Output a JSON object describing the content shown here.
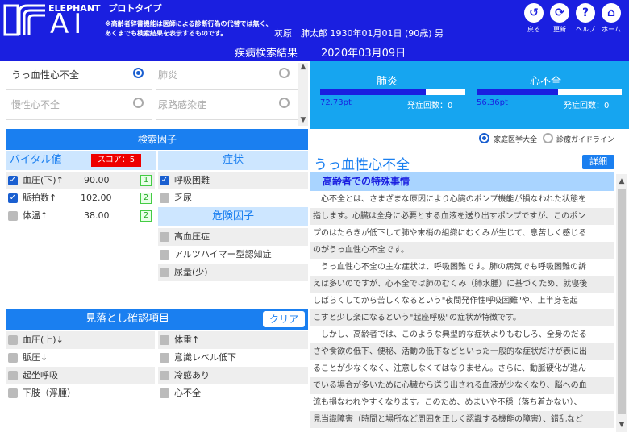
{
  "header": {
    "brand_top": "ELEPHANT",
    "prototype": "プロトタイプ",
    "brand_ai": "AI",
    "disclaimer_line1": "※高齢者辞書機能は医師による診断行為の代替では無く、",
    "disclaimer_line2": "あくまでも検索結果を表示するものです。",
    "patient_info": "灰原　肺太郎 1930年01月01日 (90歳) 男",
    "buttons": [
      {
        "icon": "back-icon",
        "glyph": "↺",
        "label": "戻る"
      },
      {
        "icon": "refresh-icon",
        "glyph": "⟳",
        "label": "更新"
      },
      {
        "icon": "help-icon",
        "glyph": "?",
        "label": "ヘルプ"
      },
      {
        "icon": "home-icon",
        "glyph": "⌂",
        "label": "ホーム"
      }
    ]
  },
  "search_bar": {
    "title": "疾病検索結果",
    "date": "2020年03月09日"
  },
  "diseases": [
    {
      "label": "うっ血性心不全",
      "selected": true
    },
    {
      "label": "肺炎",
      "selected": false
    },
    {
      "label": "慢性心不全",
      "selected": false
    },
    {
      "label": "尿路感染症",
      "selected": false
    }
  ],
  "results": [
    {
      "name": "肺炎",
      "score": "72.73pt",
      "fraction": 0.73,
      "count_label": "発症回数：0"
    },
    {
      "name": "心不全",
      "score": "56.36pt",
      "fraction": 0.56,
      "count_label": "発症回数：0"
    }
  ],
  "factors": {
    "title": "検索因子",
    "vitals_title": "バイタル値",
    "score_label": "スコア：5",
    "symptoms_title": "症状",
    "risk_title": "危険因子",
    "vitals": [
      {
        "label": "血圧(下)↑",
        "value": "90.00",
        "count": "1",
        "checked": true
      },
      {
        "label": "脈拍数↑",
        "value": "102.00",
        "count": "2",
        "checked": true
      },
      {
        "label": "体温↑",
        "value": "38.00",
        "count": "2",
        "checked": false
      }
    ],
    "symptoms": [
      {
        "label": "呼吸困難",
        "checked": true
      },
      {
        "label": "乏尿",
        "checked": false
      }
    ],
    "risks": [
      {
        "label": "高血圧症"
      },
      {
        "label": "アルツハイマー型認知症"
      },
      {
        "label": "尿量(少)"
      }
    ]
  },
  "checklist": {
    "title": "見落とし確認項目",
    "clear_label": "クリア",
    "left": [
      "血圧(上)↓",
      "脈圧↓",
      "起坐呼吸",
      "下肢（浮腫）"
    ],
    "right": [
      "体重↑",
      "意識レベル低下",
      "冷感あり",
      "心不全"
    ]
  },
  "source": {
    "option1": "家庭医学大全",
    "option2": "診療ガイドライン",
    "selected": 1
  },
  "detail": {
    "title": "うっ血性心不全",
    "button": "詳細",
    "section": "高齢者での特殊事情",
    "lines": [
      "　心不全とは、さまざまな原因により心臓のポンプ機能が損なわれた状態を",
      "指します。心臓は全身に必要とする血液を送り出すポンプですが、このポン",
      "プのはたらきが低下して肺や末梢の組織にむくみが生じて、息苦しく感じる",
      "のがうっ血性心不全です。",
      "　うっ血性心不全の主な症状は、呼吸困難です。肺の病気でも呼吸困難の訴",
      "えは多いのですが、心不全では肺のむくみ（肺水腫）に基づくため、就寝後",
      "しばらくしてから苦しくなるという\"夜間発作性呼吸困難\"や、上半身を起",
      "こすと少し楽になるという\"起座呼吸\"の症状が特徴です。",
      "　しかし、高齢者では、このような典型的な症状よりもむしろ、全身のだる",
      "さや食欲の低下、便秘、活動の低下などといった一般的な症状だけが表に出",
      "ることが少なくなく、注意しなくてはなりません。さらに、動脈硬化が進ん",
      "でいる場合が多いために心臓から送り出される血液が少なくなり、脳への血",
      "流も損なわれやすくなります。このため、めまいや不穏（落ち着かない）、",
      "見当識障害（時間と場所など周囲を正しく認識する機能の障害）、錯乱など"
    ]
  }
}
